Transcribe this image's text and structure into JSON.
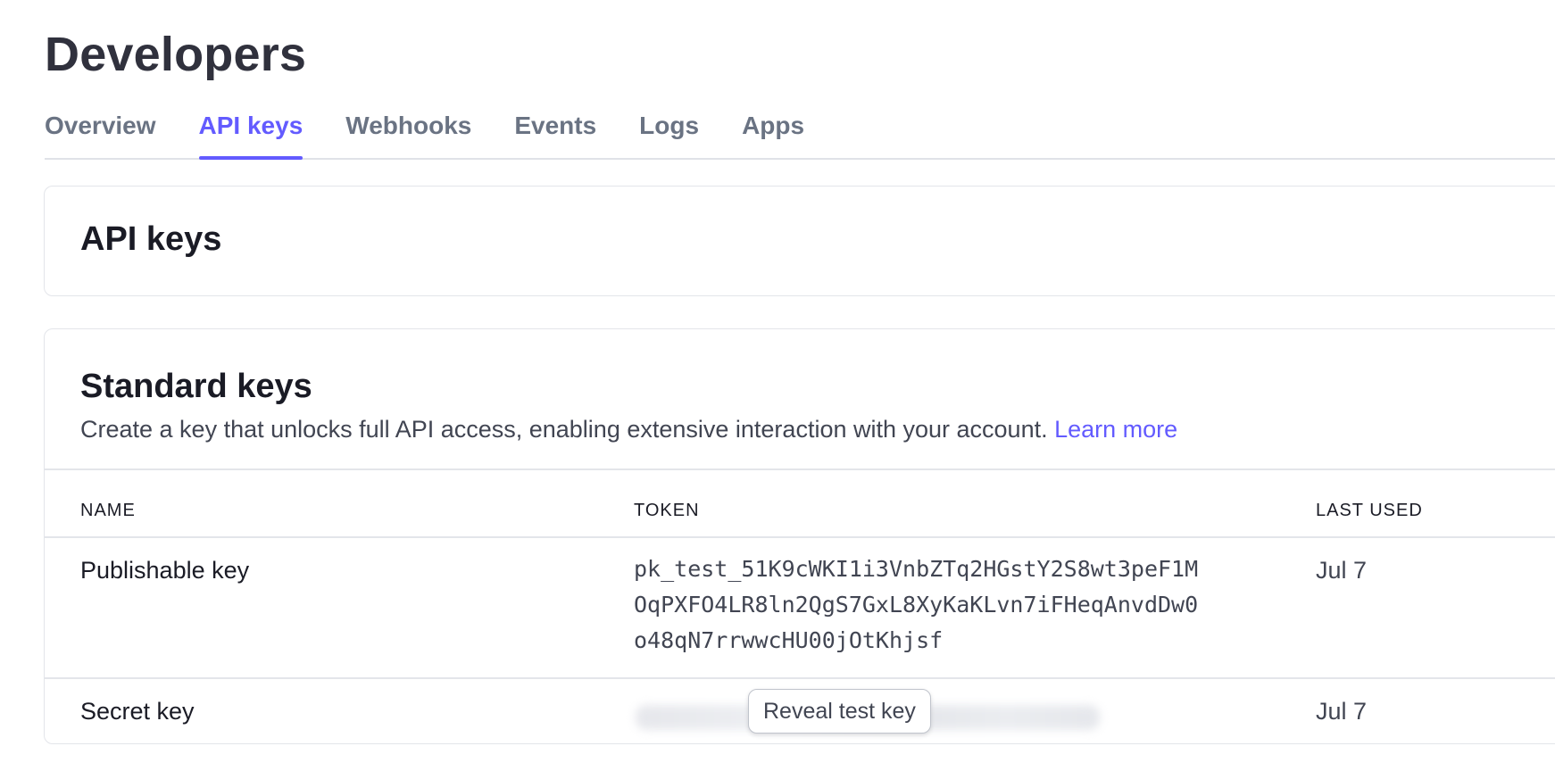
{
  "page": {
    "title": "Developers"
  },
  "tabs": [
    {
      "label": "Overview",
      "active": false
    },
    {
      "label": "API keys",
      "active": true
    },
    {
      "label": "Webhooks",
      "active": false
    },
    {
      "label": "Events",
      "active": false
    },
    {
      "label": "Logs",
      "active": false
    },
    {
      "label": "Apps",
      "active": false
    }
  ],
  "api_keys_card": {
    "title": "API keys"
  },
  "standard_keys": {
    "title": "Standard keys",
    "description": "Create a key that unlocks full API access, enabling extensive interaction with your account.",
    "learn_more": "Learn more",
    "columns": {
      "name": "NAME",
      "token": "TOKEN",
      "last_used": "LAST USED"
    },
    "rows": [
      {
        "name": "Publishable key",
        "token": "pk_test_51K9cWKI1i3VnbZTq2HGstY2S8wt3peF1M\nOqPXFO4LR8ln2QgS7GxL8XyKaKLvn7iFHeqAnvdDw0\no48qN7rrwwcHU00jOtKhjsf",
        "last_used": "Jul 7"
      },
      {
        "name": "Secret key",
        "reveal_label": "Reveal test key",
        "last_used": "Jul 7"
      }
    ]
  },
  "colors": {
    "accent": "#635bff",
    "title_text": "#30313d",
    "muted_text": "#6a7383",
    "border": "#e3e5ea"
  }
}
